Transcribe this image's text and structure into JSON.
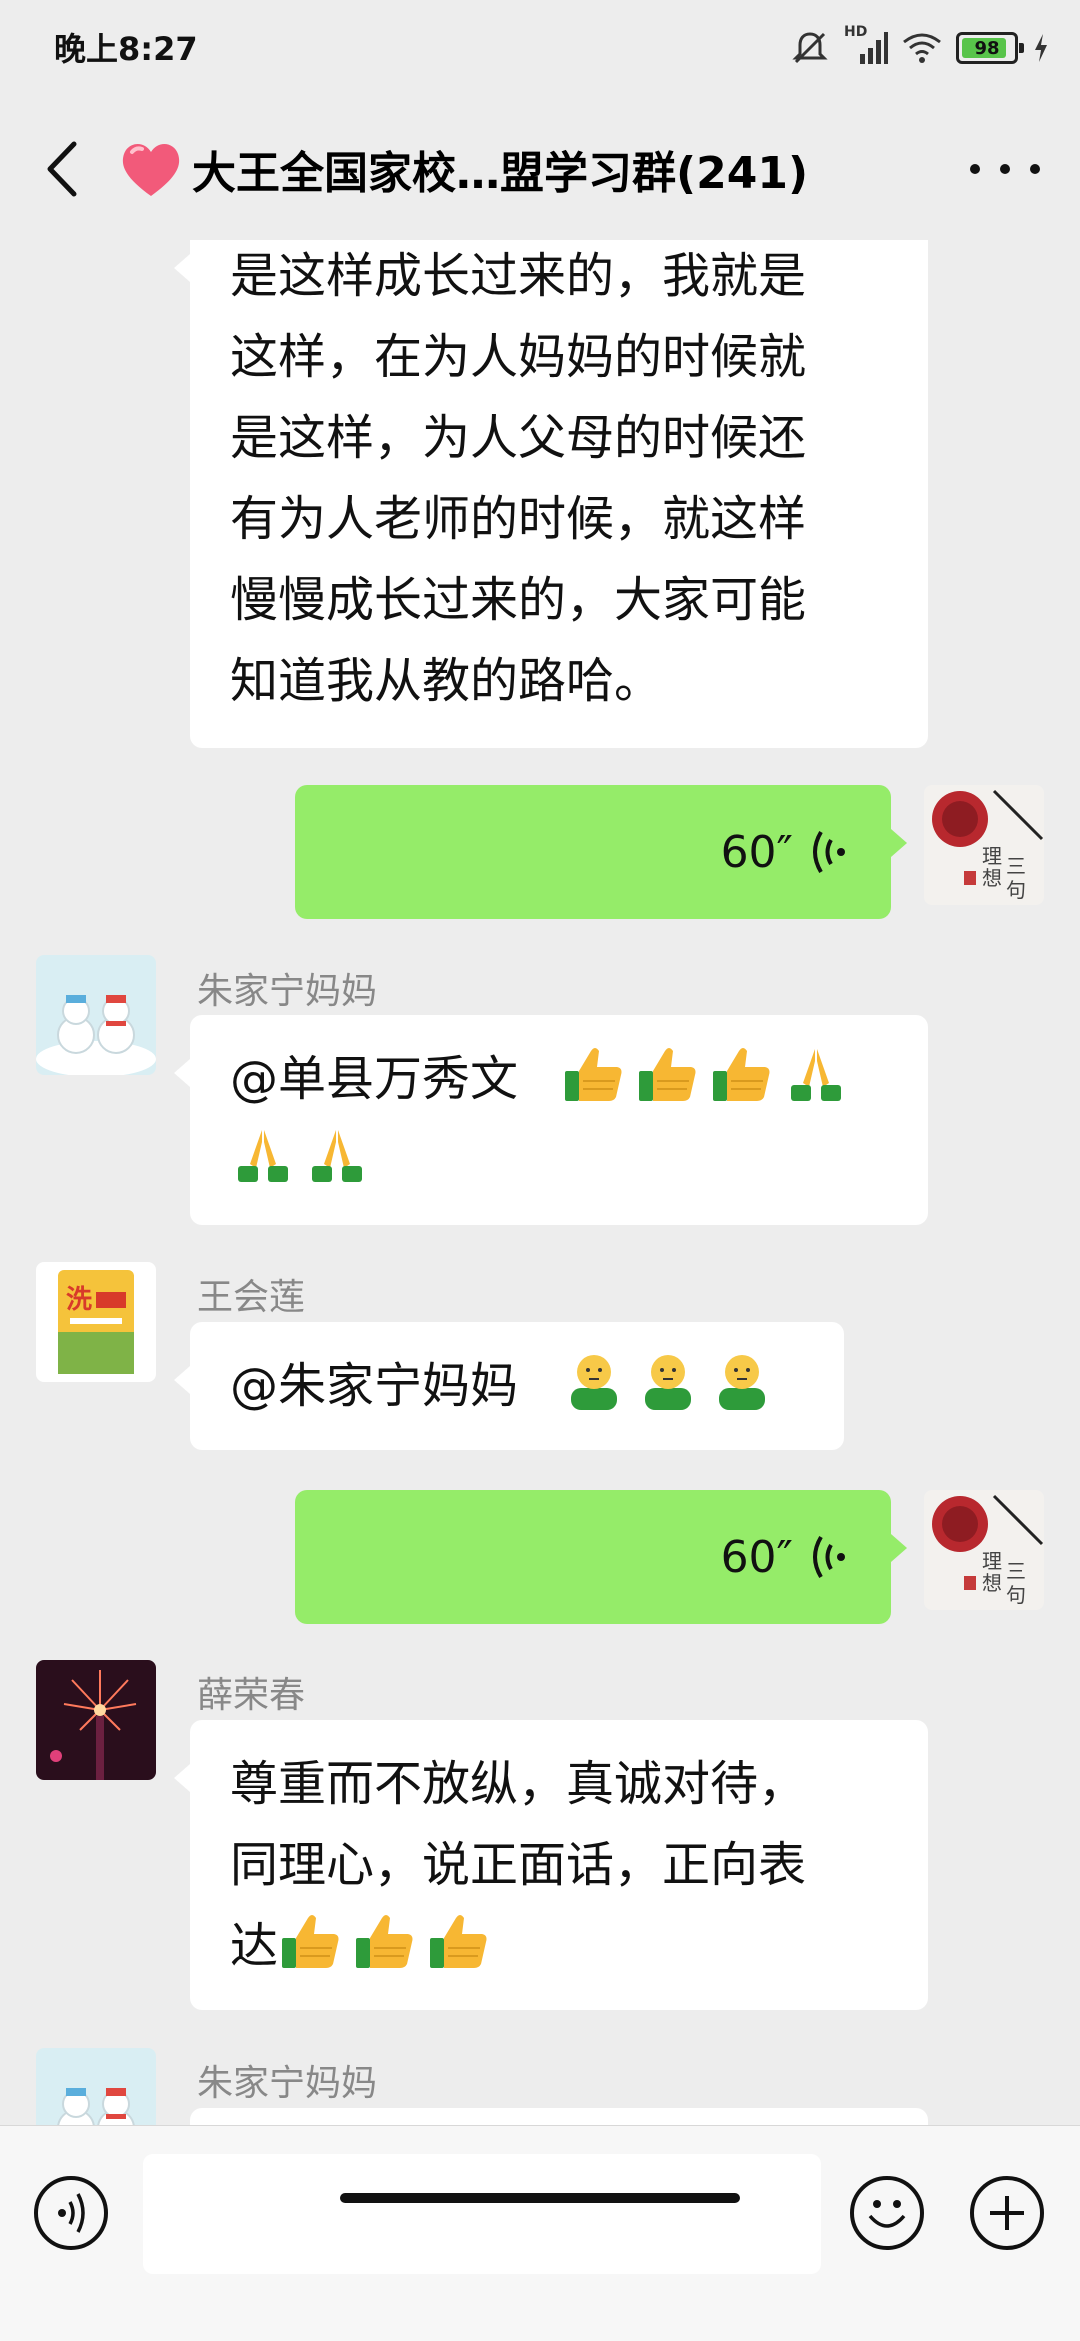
{
  "status_bar": {
    "time": "晚上8:27",
    "network_label": "HD",
    "battery": "98",
    "battery_color": "#58c44a"
  },
  "header": {
    "title": "大王全国家校…盟学习群(241)",
    "heart_icon": "heart-icon",
    "back_icon": "chevron-left-icon",
    "more_icon": "more-icon"
  },
  "messages": [
    {
      "type": "text",
      "direction": "in",
      "lines": [
        "是这样成长过来的，我就是",
        "这样，在为人妈妈的时候就",
        "是这样，为人父母的时候还",
        "有为人老师的时候，就这样",
        "慢慢成长过来的，大家可能",
        "知道我从教的路哈。"
      ]
    },
    {
      "type": "voice",
      "direction": "out",
      "duration": "60″"
    },
    {
      "type": "text",
      "direction": "in",
      "sender": "朱家宁妈妈",
      "text": "@单县万秀文",
      "emojis": [
        "thumbs-up",
        "thumbs-up",
        "thumbs-up",
        "folded-hands",
        "folded-hands",
        "folded-hands"
      ]
    },
    {
      "type": "text",
      "direction": "in",
      "sender": "王会莲",
      "text": "@朱家宁妈妈",
      "emojis": [
        "person-emoji",
        "person-emoji",
        "person-emoji"
      ]
    },
    {
      "type": "voice",
      "direction": "out",
      "duration": "60″"
    },
    {
      "type": "text",
      "direction": "in",
      "sender": "薛荣春",
      "lines": [
        "尊重而不放纵，真诚对待，",
        "同理心，说正面话，正向表",
        "达"
      ],
      "emojis": [
        "thumbs-up",
        "thumbs-up",
        "thumbs-up"
      ]
    },
    {
      "type": "text",
      "direction": "in",
      "sender": "朱家宁妈妈"
    }
  ],
  "input_bar": {
    "voice_icon": "voice-mode-icon",
    "emoji_icon": "emoji-icon",
    "plus_icon": "plus-icon",
    "placeholder": ""
  },
  "colors": {
    "background": "#ededed",
    "outgoing_bubble": "#95ec69",
    "incoming_bubble": "#ffffff"
  }
}
